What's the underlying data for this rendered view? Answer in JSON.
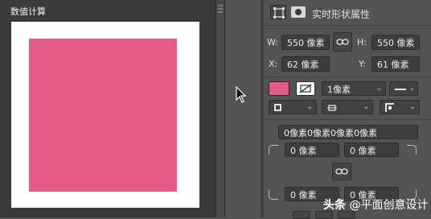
{
  "canvas_panel": {
    "title": "数值计算",
    "shape_fill": "#e55a86",
    "doc_bg": "#ffffff"
  },
  "properties": {
    "header": {
      "icons": [
        "transform-icon",
        "mask-icon"
      ],
      "title": "实时形状属性"
    },
    "size": {
      "w_label": "W:",
      "w_value": "550 像素",
      "h_label": "H:",
      "h_value": "550 像素",
      "link_icon": "link-icon"
    },
    "position": {
      "x_label": "X:",
      "x_value": "62 像素",
      "y_label": "Y:",
      "y_value": "61 像素"
    },
    "appearance": {
      "fill_color": "#e55a86",
      "stroke": "none",
      "stroke_width": "1像素",
      "stroke_style": "solid-line"
    },
    "align_row": [
      "stroke-align-icon",
      "line-cap-icon",
      "line-join-icon"
    ],
    "corner_radius": {
      "combined": "0像素0像素0像素0像素",
      "top_left": "0 像素",
      "top_right": "0 像素",
      "bottom_left": "0 像素",
      "bottom_right": "0 像素",
      "link_icon": "link-icon"
    }
  },
  "watermark": {
    "brand": "头条",
    "handle": "@平面创意设计"
  },
  "colors": {
    "panel_bg": "#535353",
    "field_bg": "#3d3d3d",
    "canvas_bg": "#3a3a3a"
  }
}
